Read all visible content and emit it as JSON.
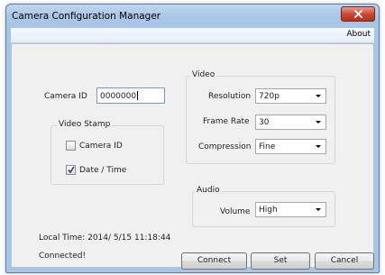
{
  "window": {
    "title": "Camera Configuration Manager",
    "close_icon": "close-icon"
  },
  "menu": {
    "about": "About"
  },
  "camera_id": {
    "label": "Camera ID",
    "value": "0000000"
  },
  "video_stamp": {
    "title": "Video Stamp",
    "camera_id_label": "Camera ID",
    "camera_id_checked": false,
    "datetime_label": "Date / Time",
    "datetime_checked": true
  },
  "video": {
    "title": "Video",
    "resolution_label": "Resolution",
    "resolution_value": "720p",
    "frame_rate_label": "Frame Rate",
    "frame_rate_value": "30",
    "compression_label": "Compression",
    "compression_value": "Fine"
  },
  "audio": {
    "title": "Audio",
    "volume_label": "Volume",
    "volume_value": "High"
  },
  "status": {
    "local_time": "Local Time: 2014/ 5/15 11:18:44",
    "connection": "Connected!"
  },
  "buttons": {
    "connect": "Connect",
    "set": "Set",
    "cancel": "Cancel"
  },
  "colors": {
    "title_bar": "#a9c5e6",
    "close_button": "#c8442f",
    "client_background": "#f0f0f0"
  }
}
